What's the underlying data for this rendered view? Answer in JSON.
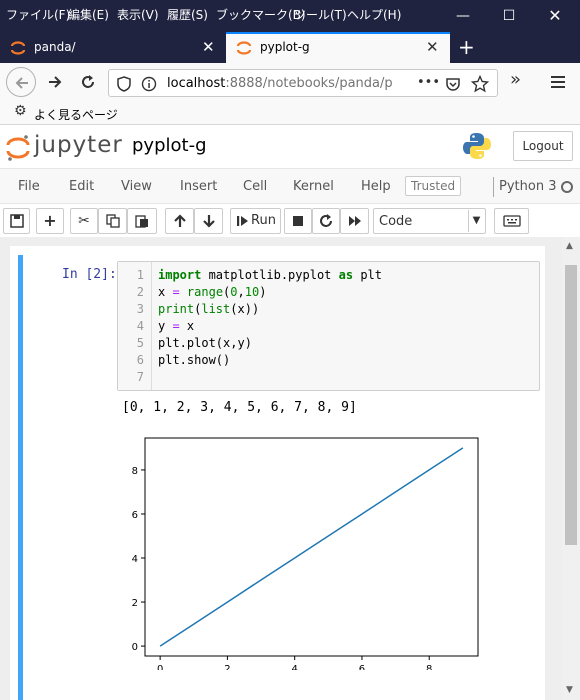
{
  "browser": {
    "menu": [
      "ファイル(F)",
      "編集(E)",
      "表示(V)",
      "履歴(S)",
      "ブックマーク(B)",
      "ツール(T)",
      "ヘルプ(H)"
    ],
    "tabs": [
      {
        "title": "panda/"
      },
      {
        "title": "pyplot-g"
      }
    ],
    "url": {
      "host": "localhost",
      "rest": ":8888/notebooks/panda/p",
      "more": "•••"
    },
    "bookmark": "よく見るページ"
  },
  "jupyter": {
    "logo_text": "jupyter",
    "notebook_name": "pyplot-g",
    "logout_label": "Logout",
    "menu": [
      "File",
      "Edit",
      "View",
      "Insert",
      "Cell",
      "Kernel",
      "Help"
    ],
    "trusted": "Trusted",
    "kernel": "Python 3",
    "toolbar": {
      "run_label": "Run",
      "cell_type": "Code"
    }
  },
  "cell": {
    "prompt": "In [2]:",
    "line_numbers": [
      "1",
      "2",
      "3",
      "4",
      "5",
      "6",
      "7"
    ],
    "code": [
      "import matplotlib.pyplot as plt",
      "x = range(0,10)",
      "print(list(x))",
      "y = x",
      "plt.plot(x,y)",
      "plt.show()",
      ""
    ],
    "output_text": "[0, 1, 2, 3, 4, 5, 6, 7, 8, 9]"
  },
  "chart_data": {
    "type": "line",
    "x": [
      0,
      1,
      2,
      3,
      4,
      5,
      6,
      7,
      8,
      9
    ],
    "series": [
      {
        "values": [
          0,
          1,
          2,
          3,
          4,
          5,
          6,
          7,
          8,
          9
        ],
        "color": "#1f77b4"
      }
    ],
    "xticks": [
      "0",
      "2",
      "4",
      "6",
      "8"
    ],
    "yticks": [
      "0",
      "2",
      "4",
      "6",
      "8"
    ],
    "xlim": [
      -0.45,
      9.45
    ],
    "ylim": [
      -0.45,
      9.45
    ],
    "title": "",
    "xlabel": "",
    "ylabel": "",
    "grid": false
  },
  "colors": {
    "accent": "#42a5f5",
    "titlebar": "#202340",
    "tab_active_line": "#0a84ff",
    "jupyter_orange": "#f37726"
  }
}
